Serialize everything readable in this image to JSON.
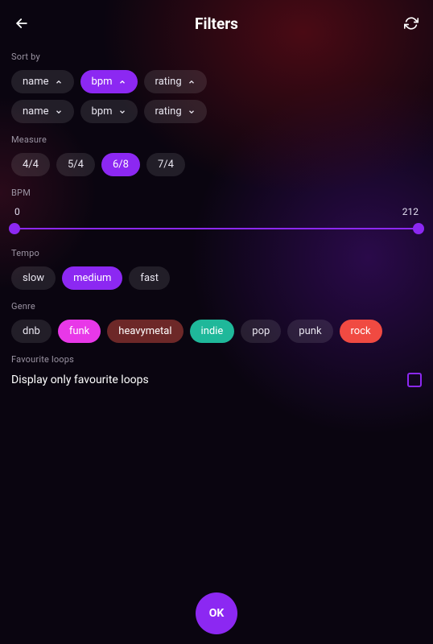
{
  "header": {
    "title": "Filters"
  },
  "sections": {
    "sortby": {
      "label": "Sort by",
      "row1": [
        {
          "label": "name",
          "dir": "up",
          "active": false
        },
        {
          "label": "bpm",
          "dir": "up",
          "active": true
        },
        {
          "label": "rating",
          "dir": "up",
          "active": false
        }
      ],
      "row2": [
        {
          "label": "name",
          "dir": "down",
          "active": false
        },
        {
          "label": "bpm",
          "dir": "down",
          "active": false
        },
        {
          "label": "rating",
          "dir": "down",
          "active": false
        }
      ]
    },
    "measure": {
      "label": "Measure",
      "options": [
        {
          "label": "4/4",
          "active": false
        },
        {
          "label": "5/4",
          "active": false
        },
        {
          "label": "6/8",
          "active": true
        },
        {
          "label": "7/4",
          "active": false
        }
      ]
    },
    "bpm": {
      "label": "BPM",
      "min": "0",
      "max": "212"
    },
    "tempo": {
      "label": "Tempo",
      "options": [
        {
          "label": "slow",
          "active": false
        },
        {
          "label": "medium",
          "active": true
        },
        {
          "label": "fast",
          "active": false
        }
      ]
    },
    "genre": {
      "label": "Genre",
      "options": [
        {
          "label": "dnb",
          "cls": ""
        },
        {
          "label": "funk",
          "cls": "genre-funk"
        },
        {
          "label": "heavymetal",
          "cls": "genre-heavymetal"
        },
        {
          "label": "indie",
          "cls": "genre-indie"
        },
        {
          "label": "pop",
          "cls": ""
        },
        {
          "label": "punk",
          "cls": ""
        },
        {
          "label": "rock",
          "cls": "genre-rock"
        }
      ]
    },
    "favourite": {
      "label": "Favourite loops",
      "text": "Display only favourite loops"
    }
  },
  "ok_label": "OK"
}
